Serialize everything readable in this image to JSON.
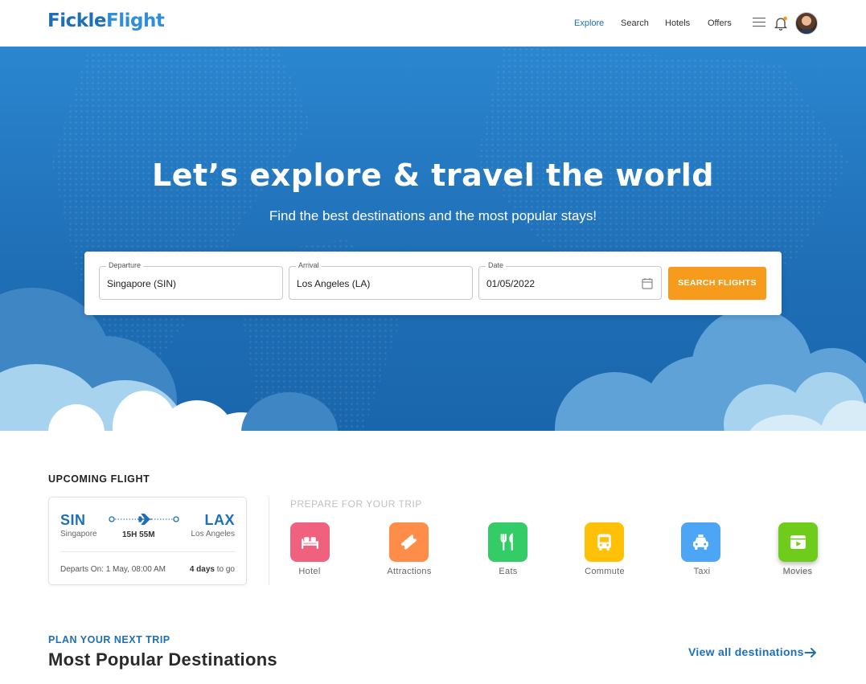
{
  "header": {
    "logo_part1": "Fickle",
    "logo_part2": "Flight",
    "nav": [
      "Explore",
      "Search",
      "Hotels",
      "Offers"
    ],
    "active_nav": "Explore"
  },
  "hero": {
    "title": "Let’s explore & travel the world",
    "subtitle": "Find the best destinations and the most popular stays!"
  },
  "search": {
    "departure_label": "Departure",
    "departure_value": "Singapore (SIN)",
    "arrival_label": "Arrival",
    "arrival_value": "Los Angeles (LA)",
    "date_label": "Date",
    "date_value": "01/05/2022",
    "button_label": "SEARCH FLIGHTS"
  },
  "upcoming": {
    "heading": "UPCOMING FLIGHT",
    "from_code": "SIN",
    "from_city": "Singapore",
    "to_code": "LAX",
    "to_city": "Los Angeles",
    "duration": "15H 55M",
    "departs": "Departs On: 1 May, 08:00 AM",
    "days_bold": "4 days",
    "days_rest": " to go"
  },
  "prepare": {
    "heading": "PREPARE FOR YOUR TRIP",
    "items": [
      {
        "label": "Hotel",
        "icon": "bed-icon",
        "color": "#f0607f"
      },
      {
        "label": "Attractions",
        "icon": "ticket-icon",
        "color": "#ff8d4a"
      },
      {
        "label": "Eats",
        "icon": "utensils-icon",
        "color": "#33cc66"
      },
      {
        "label": "Commute",
        "icon": "bus-icon",
        "color": "#ffc107"
      },
      {
        "label": "Taxi",
        "icon": "taxi-icon",
        "color": "#4da6f5"
      },
      {
        "label": "Movies",
        "icon": "movie-icon",
        "color": "#6fcc1a"
      }
    ]
  },
  "plan": {
    "kicker": "PLAN YOUR NEXT TRIP",
    "title": "Most Popular Destinations",
    "view_all": "View all destinations"
  },
  "colors": {
    "brand": "#1e6fb6",
    "accent": "#f79b1d",
    "hero": "#1f6fb6"
  }
}
